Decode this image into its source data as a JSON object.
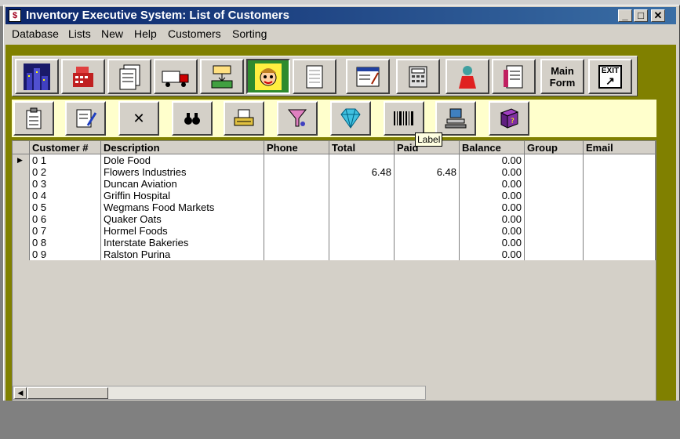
{
  "window": {
    "title": "Inventory Executive System: List of Customers",
    "app_icon_glyph": "$",
    "controls": {
      "minimize": "_",
      "maximize": "□",
      "close": "✕"
    }
  },
  "menu": [
    "Database",
    "Lists",
    "New",
    "Help",
    "Customers",
    "Sorting"
  ],
  "toolbar1": {
    "icons": [
      "city-icon",
      "cash-register-icon",
      "documents-icon",
      "delivery-truck-icon",
      "money-transfer-icon",
      "customer-face-icon",
      "blank-page-icon",
      "form-edit-icon",
      "calculator-icon",
      "person-icon",
      "list-page-icon"
    ],
    "main_form_label": "Main\nForm",
    "exit_label": "EXIT"
  },
  "toolbar2": {
    "icons": [
      "paste-icon",
      "edit-note-icon",
      "delete-icon",
      "binoculars-icon",
      "typewriter-icon",
      "funnel-icon",
      "diamond-icon",
      "barcode-icon",
      "computer-network-icon",
      "help-book-icon"
    ],
    "delete_glyph": "✕",
    "binoculars_glyph": "⛯"
  },
  "tooltip": "Label",
  "grid": {
    "columns": [
      "Customer #",
      "Description",
      "Phone",
      "Total",
      "Paid",
      "Balance",
      "Group",
      "Email"
    ],
    "rows": [
      {
        "id": "0 1",
        "desc": "Dole Food",
        "phone": "",
        "total": "",
        "paid": "",
        "balance": "0.00",
        "group": "",
        "email": ""
      },
      {
        "id": "0 2",
        "desc": "Flowers Industries",
        "phone": "",
        "total": "6.48",
        "paid": "6.48",
        "balance": "0.00",
        "group": "",
        "email": ""
      },
      {
        "id": "0 3",
        "desc": "Duncan Aviation",
        "phone": "",
        "total": "",
        "paid": "",
        "balance": "0.00",
        "group": "",
        "email": ""
      },
      {
        "id": "0 4",
        "desc": "Griffin Hospital",
        "phone": "",
        "total": "",
        "paid": "",
        "balance": "0.00",
        "group": "",
        "email": ""
      },
      {
        "id": "0 5",
        "desc": "Wegmans Food Markets",
        "phone": "",
        "total": "",
        "paid": "",
        "balance": "0.00",
        "group": "",
        "email": ""
      },
      {
        "id": "0 6",
        "desc": "Quaker Oats",
        "phone": "",
        "total": "",
        "paid": "",
        "balance": "0.00",
        "group": "",
        "email": ""
      },
      {
        "id": "0 7",
        "desc": "Hormel Foods",
        "phone": "",
        "total": "",
        "paid": "",
        "balance": "0.00",
        "group": "",
        "email": ""
      },
      {
        "id": "0 8",
        "desc": "Interstate Bakeries",
        "phone": "",
        "total": "",
        "paid": "",
        "balance": "0.00",
        "group": "",
        "email": ""
      },
      {
        "id": "0 9",
        "desc": "Ralston Purina",
        "phone": "",
        "total": "",
        "paid": "",
        "balance": "0.00",
        "group": "",
        "email": ""
      }
    ],
    "current_row_marker": "▶"
  },
  "navigator": {
    "first": "|◀",
    "prev": "◀",
    "next": "▶",
    "last": "▶|"
  },
  "colors": {
    "client_bg": "#808000",
    "toolbar2_bg": "#ffffcc",
    "title_start": "#0a246a",
    "title_end": "#3a6ea5"
  }
}
